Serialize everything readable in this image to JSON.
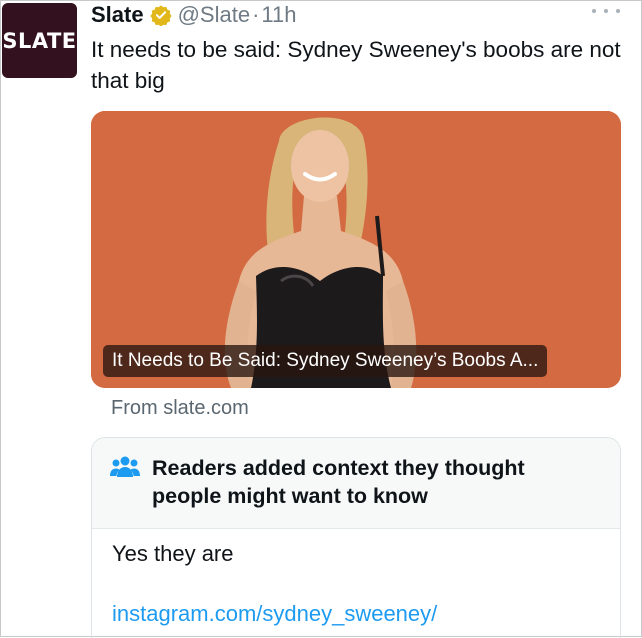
{
  "tweet": {
    "avatar_text": "SLATE",
    "display_name": "Slate",
    "handle": "@Slate",
    "separator": "·",
    "time": "11h",
    "text": "It needs to be said: Sydney Sweeney's boobs are not that big",
    "icons": {
      "verified": "verified-badge-icon",
      "more": "more-options-icon"
    }
  },
  "card": {
    "caption": "It Needs to Be Said: Sydney Sweeney’s Boobs A...",
    "source": "From slate.com",
    "background_color": "#d46a41"
  },
  "community_note": {
    "icon": "people-icon",
    "title": "Readers added context they thought people might want to know",
    "body": "Yes they are",
    "link": "instagram.com/sydney_sweeney/"
  },
  "colors": {
    "link": "#1d9bf0",
    "verified": "#e2b719",
    "muted": "#6f7a84"
  }
}
